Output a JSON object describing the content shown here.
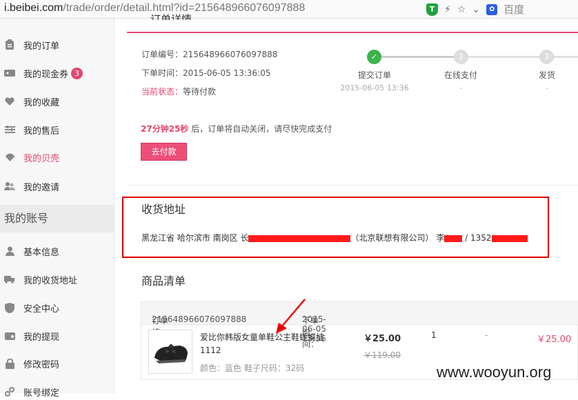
{
  "browser": {
    "url_domain": "i.beibei.com",
    "url_path": "/trade/order/detail.html?id=215648966076097888",
    "search_engine": "百度"
  },
  "sidebar": {
    "items": [
      {
        "label": "我的订单",
        "icon": "clipboard-icon"
      },
      {
        "label": "我的现金券",
        "icon": "ticket-icon",
        "badge": "3"
      },
      {
        "label": "我的收藏",
        "icon": "heart-icon"
      },
      {
        "label": "我的售后",
        "icon": "sliders-icon"
      },
      {
        "label": "我的贝壳",
        "icon": "shell-icon",
        "active": true
      },
      {
        "label": "我的邀请",
        "icon": "users-icon"
      }
    ],
    "section_title": "我的账号",
    "account_items": [
      {
        "label": "基本信息",
        "icon": "user-icon"
      },
      {
        "label": "我的收货地址",
        "icon": "truck-icon"
      },
      {
        "label": "安全中心",
        "icon": "shield-icon"
      },
      {
        "label": "我的提现",
        "icon": "wallet-icon"
      },
      {
        "label": "修改密码",
        "icon": "lock-icon"
      },
      {
        "label": "账号绑定",
        "icon": "link-icon"
      }
    ]
  },
  "order": {
    "section_title": "订单详情",
    "number_label": "订单编号：",
    "number": "215648966076097888",
    "time_label": "下单时间：",
    "time": "2015-06-05 13:36:05",
    "status_label": "当前状态：",
    "status": "等待付款",
    "countdown": "27分钟25秒",
    "countdown_suffix": " 后，订单将自动关闭，请尽快完成支付",
    "pay_button": "去付款"
  },
  "progress": {
    "steps": [
      {
        "num": "✓",
        "label": "提交订单",
        "time": "2015-06-05 13:36",
        "done": true
      },
      {
        "num": "2",
        "label": "在线支付",
        "time": "-",
        "done": false
      },
      {
        "num": "3",
        "label": "发货",
        "time": "-",
        "done": false
      }
    ]
  },
  "address": {
    "title": "收货地址",
    "region": "黑龙江省 哈尔滨市 南岗区 ",
    "company": "（北京联想有限公司）",
    "name_prefix": "李",
    "phone_prefix": " / 1352"
  },
  "goods": {
    "title": "商品清单",
    "header_number_label": "订单编号：",
    "header_number": "215648966076097888",
    "header_time_label": "下单时间：",
    "header_time": "2015-06-05 13:36",
    "item": {
      "name": "爱比你韩版女童单鞋公主鞋蝴蝶结1112",
      "attrs": "颜色：蓝色   鞋子尺码：32码",
      "price": "￥25.00",
      "old_price": "￥119.00",
      "qty": "1",
      "discount": "-",
      "total": "￥25.00"
    }
  },
  "watermark": "www.wooyun.org"
}
